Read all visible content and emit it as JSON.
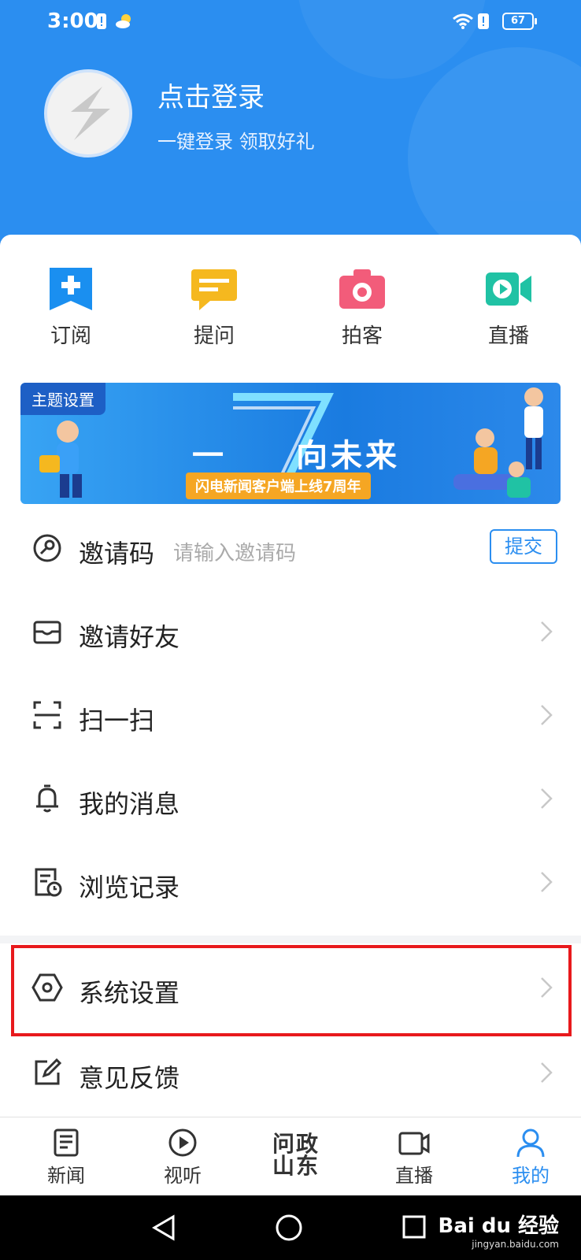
{
  "status_bar": {
    "time": "3:00",
    "battery": "67"
  },
  "profile": {
    "login_title": "点击登录",
    "login_subtitle": "一键登录 领取好礼"
  },
  "quick_actions": [
    {
      "label": "订阅",
      "icon": "subscribe-icon",
      "color": "#1a8ff0"
    },
    {
      "label": "提问",
      "icon": "question-icon",
      "color": "#f5b81f"
    },
    {
      "label": "拍客",
      "icon": "camera-icon",
      "color": "#f25c7a"
    },
    {
      "label": "直播",
      "icon": "live-video-icon",
      "color": "#20c2a4"
    }
  ],
  "banner": {
    "tag": "主题设置",
    "headline_left": "一",
    "headline_right": "向未来",
    "ribbon": "闪电新闻客户端上线7周年"
  },
  "invite": {
    "label": "邀请码",
    "placeholder": "请输入邀请码",
    "submit_label": "提交"
  },
  "menu": [
    {
      "label": "邀请好友",
      "icon": "invite-friends-icon"
    },
    {
      "label": "扫一扫",
      "icon": "scan-icon"
    },
    {
      "label": "我的消息",
      "icon": "bell-icon"
    },
    {
      "label": "浏览记录",
      "icon": "history-icon"
    }
  ],
  "settings_menu": [
    {
      "label": "系统设置",
      "icon": "settings-icon"
    },
    {
      "label": "意见反馈",
      "icon": "feedback-icon"
    }
  ],
  "tabs": [
    {
      "label": "新闻",
      "icon": "news-icon",
      "active": false
    },
    {
      "label": "视听",
      "icon": "play-icon",
      "active": false
    },
    {
      "label": "问政山东",
      "icon": "wenzheng-logo",
      "active": false
    },
    {
      "label": "直播",
      "icon": "live-icon",
      "active": false
    },
    {
      "label": "我的",
      "icon": "profile-icon",
      "active": true
    }
  ],
  "watermark": {
    "brand": "Bai du 经验",
    "url": "jingyan.baidu.com"
  },
  "colors": {
    "header_blue": "#2b8ef0",
    "highlight_red": "#e8191c"
  }
}
